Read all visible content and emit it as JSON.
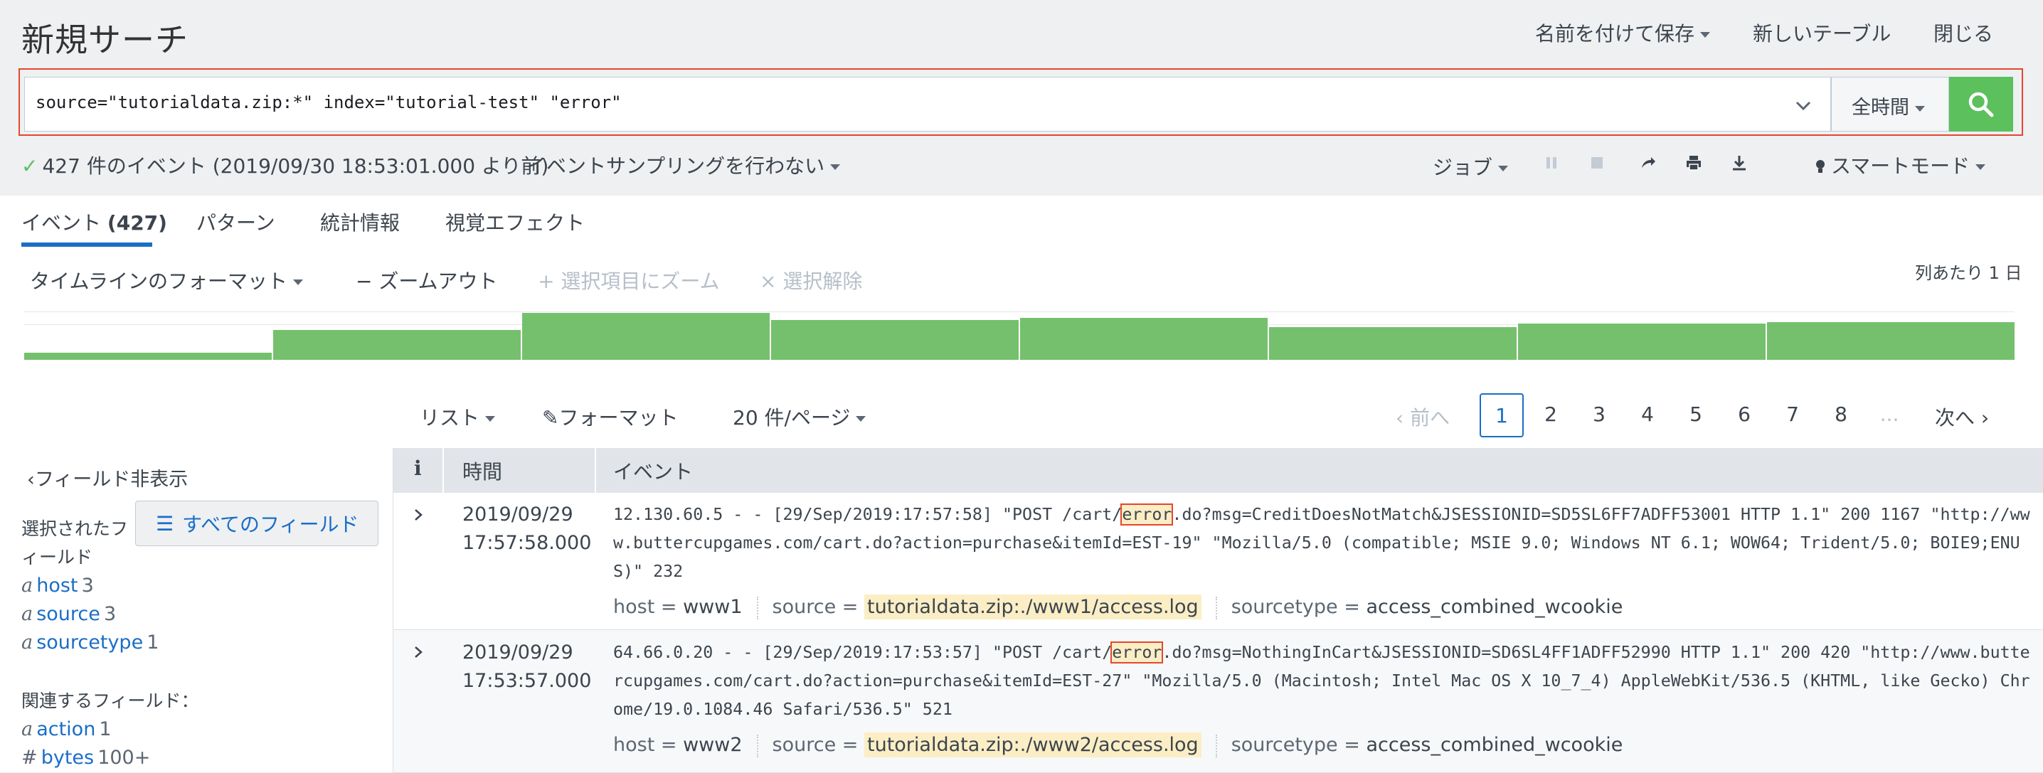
{
  "header": {
    "title": "新規サーチ",
    "save_as": "名前を付けて保存",
    "new_table": "新しいテーブル",
    "close": "閉じる"
  },
  "search": {
    "query": "source=\"tutorialdata.zip:*\" index=\"tutorial-test\" \"error\"",
    "time_range": "全時間",
    "submit_icon": "search-icon"
  },
  "status": {
    "summary": "427 件のイベント (2019/09/30 18:53:01.000 より前)",
    "sampling": "イベントサンプリングを行わない",
    "job": "ジョブ",
    "mode": "スマートモード"
  },
  "tabs": [
    {
      "label": "イベント",
      "count": "(427)",
      "active": true
    },
    {
      "label": "パターン"
    },
    {
      "label": "統計情報"
    },
    {
      "label": "視覚エフェクト"
    }
  ],
  "timeline": {
    "format": "タイムラインのフォーマット",
    "zoom_out": "ズームアウト",
    "zoom_selection": "選択項目にズーム",
    "deselect": "選択解除",
    "scale": "列あたり 1 日",
    "bar_levels": [
      0.15,
      0.63,
      1.0,
      0.85,
      0.9,
      0.7,
      0.77,
      0.8
    ],
    "bar_color": "#75c06d"
  },
  "pager": {
    "view": "リスト",
    "format": "フォーマット",
    "per_page": "20 件/ページ",
    "prev": "前へ",
    "pages": [
      "1",
      "2",
      "3",
      "4",
      "5",
      "6",
      "7",
      "8"
    ],
    "ellipsis": "...",
    "next": "次へ",
    "current": "1"
  },
  "sidebar": {
    "hide_fields": "フィールド非表示",
    "all_fields": "すべてのフィールド",
    "selected_label": "選択されたフィールド",
    "selected_label_line1": "選択されたフ",
    "selected_label_line2": "ィールド",
    "selected_fields": [
      {
        "type": "a",
        "name": "host",
        "count": "3"
      },
      {
        "type": "a",
        "name": "source",
        "count": "3"
      },
      {
        "type": "a",
        "name": "sourcetype",
        "count": "1"
      }
    ],
    "related_label": "関連するフィールド：",
    "related_fields": [
      {
        "type": "a",
        "name": "action",
        "count": "1"
      },
      {
        "type": "#",
        "name": "bytes",
        "count": "100+"
      }
    ]
  },
  "table": {
    "col_info": "i",
    "col_time": "時間",
    "col_event": "イベント",
    "rows": [
      {
        "date": "2019/09/29",
        "time": "17:57:58.000",
        "event_pre": "12.130.60.5 - - [29/Sep/2019:17:57:58] \"POST /cart/",
        "event_hl": "error",
        "event_post": ".do?msg=CreditDoesNotMatch&JSESSIONID=SD5SL6FF7ADFF53001 HTTP 1.1\" 200 1167 \"http://www.buttercupgames.com/cart.do?action=purchase&itemId=EST-19\" \"Mozilla/5.0 (compatible; MSIE 9.0; Windows NT 6.1; WOW64; Trident/5.0; BOIE9;ENUS)\" 232",
        "host_key": "host =",
        "host": "www1",
        "source_key": "source =",
        "source": "tutorialdata.zip:./www1/access.log",
        "sourcetype_key": "sourcetype =",
        "sourcetype": "access_combined_wcookie"
      },
      {
        "date": "2019/09/29",
        "time": "17:53:57.000",
        "event_pre": "64.66.0.20 - - [29/Sep/2019:17:53:57] \"POST /cart/",
        "event_hl": "error",
        "event_post": ".do?msg=NothingInCart&JSESSIONID=SD6SL4FF1ADFF52990 HTTP 1.1\" 200 420 \"http://www.buttercupgames.com/cart.do?action=purchase&itemId=EST-27\" \"Mozilla/5.0 (Macintosh; Intel Mac OS X 10_7_4) AppleWebKit/536.5 (KHTML, like Gecko) Chrome/19.0.1084.46 Safari/536.5\" 521",
        "host_key": "host =",
        "host": "www2",
        "source_key": "source =",
        "source": "tutorialdata.zip:./www2/access.log",
        "sourcetype_key": "sourcetype =",
        "sourcetype": "access_combined_wcookie"
      }
    ]
  },
  "colors": {
    "accent": "#1a6ec8",
    "success": "#5cc05c",
    "highlight_border": "#e5462f",
    "term_highlight": "#fbeec5"
  }
}
